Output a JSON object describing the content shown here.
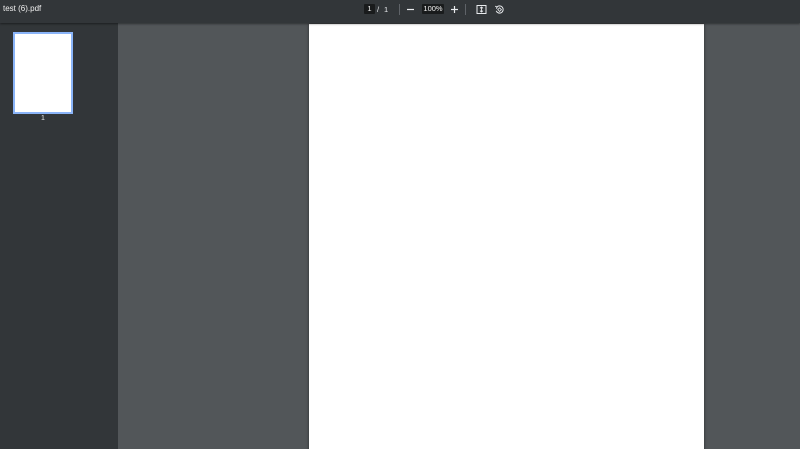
{
  "toolbar": {
    "title": "test (6).pdf",
    "page_current": "1",
    "page_separator": "/",
    "page_total": "1",
    "zoom": "100%"
  },
  "icons": {
    "zoom_out": "minus-icon",
    "zoom_in": "plus-icon",
    "fit": "fit-to-page-icon",
    "rotate": "rotate-counterclockwise-icon"
  },
  "sidebar": {
    "thumbnails": [
      {
        "label": "1",
        "selected": true
      }
    ],
    "selected_border_color": "#8ab4f8"
  },
  "colors": {
    "toolbar_bg": "#323639",
    "sidebar_bg": "#323639",
    "canvas_bg": "#525659",
    "page_bg": "#ffffff"
  }
}
